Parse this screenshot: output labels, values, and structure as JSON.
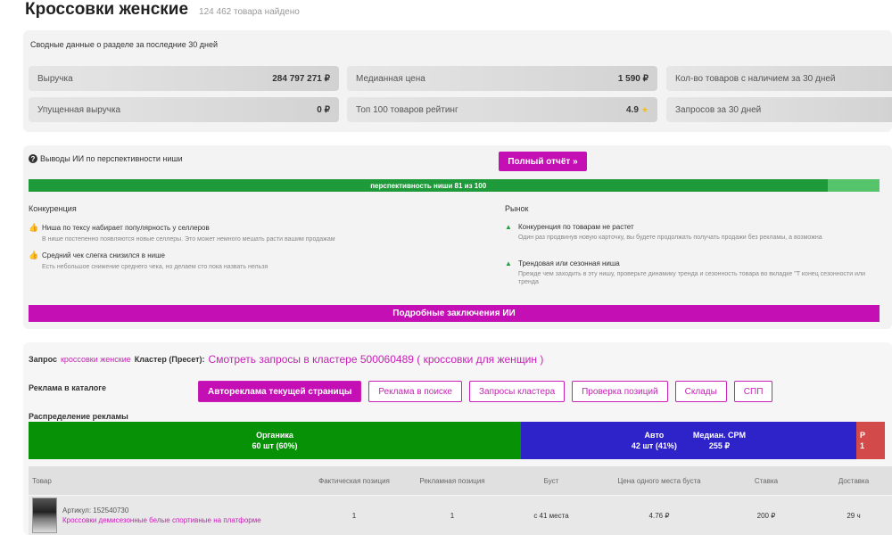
{
  "page": {
    "title": "Кроссовки женские",
    "found": "124 462 товара найдено"
  },
  "summary": {
    "title": "Сводные данные о разделе за последние 30 дней",
    "revenue": {
      "label": "Выручка",
      "value": "284 797 271 ₽"
    },
    "median_price": {
      "label": "Медианная цена",
      "value": "1 590 ₽"
    },
    "with_stock": {
      "label": "Кол-во товаров с наличием за 30 дней",
      "value": ""
    },
    "lost_revenue": {
      "label": "Упущенная выручка",
      "value": "0 ₽"
    },
    "top100_rating": {
      "label": "Топ 100 товаров рейтинг",
      "value": "4.9"
    },
    "queries": {
      "label": "Запросов за 30 дней",
      "value": ""
    }
  },
  "ai": {
    "title": "Выводы ИИ по перспективности ниши",
    "full_report": "Полный отчёт »",
    "bar_text": "перспективность ниши 81 из 100",
    "bar_score": 81,
    "competition_head": "Конкуренция",
    "market_head": "Рынок",
    "competition": [
      {
        "title": "Ниша по тексу набирает популярность у селлеров",
        "desc": "В нише постепенно появляются новые селлеры. Это может немного мешать расти вашим продажам"
      },
      {
        "title": "Средний чек слегка снизился в нише",
        "desc": "Есть небольшое снижение среднего чека, но делаем сто пока назвать нельзя"
      }
    ],
    "market": [
      {
        "title": "Конкуренция по товарам не растет",
        "desc": "Один раз продвинув новую карточку, вы будете продолжать получать продажи без рекламы, а возможна"
      },
      {
        "title": "Трендовая или сезонная ниша",
        "desc": "Прежде чем заходить в эту нишу, проверьте динамику тренда и сезонность товара во вкладке \"Т конец сезонности или тренда"
      }
    ],
    "details_button": "Подробные заключения ИИ"
  },
  "ads": {
    "query_label": "Запрос",
    "query_value": "кроссовки женские",
    "cluster_label": "Кластер (Пресет):",
    "cluster_link": "Смотреть запросы в кластере 500060489 ( кроссовки для женщин )",
    "catalog_title": "Реклама в каталоге",
    "tabs": [
      "Автореклама текущей страницы",
      "Реклама в поиске",
      "Запросы кластера",
      "Проверка позиций",
      "Склады",
      "СПП"
    ],
    "dist_title": "Распределение рекламы",
    "organic": {
      "label": "Органика",
      "value": "60 шт (60%)"
    },
    "auto": {
      "label": "Авто",
      "value": "42 шт (41%)"
    },
    "median_cpm": {
      "label": "Медиан. CPM",
      "value": "255 ₽"
    },
    "red_seg": {
      "label": "Р",
      "value": "1"
    },
    "distribution": {
      "organic_pct": 60,
      "auto_pct": 41
    },
    "table_headers": [
      "Товар",
      "Фактическая позиция",
      "Рекламная позиция",
      "Буст",
      "Цена одного места буста",
      "Ставка",
      "Доставка"
    ],
    "rows": [
      {
        "article": "Артикул: 152540730",
        "name": "Кроссовки демисезонные белые спортивные на платформе",
        "fact_pos": "1",
        "ad_pos": "1",
        "boost": "с 41 места",
        "cpm": "4.76 ₽",
        "bid": "200 ₽",
        "delivery": "29 ч"
      }
    ]
  },
  "colors": {
    "accent": "#c40fb5",
    "green": "#079107",
    "blue": "#2e22c9",
    "red": "#d34a4a"
  }
}
